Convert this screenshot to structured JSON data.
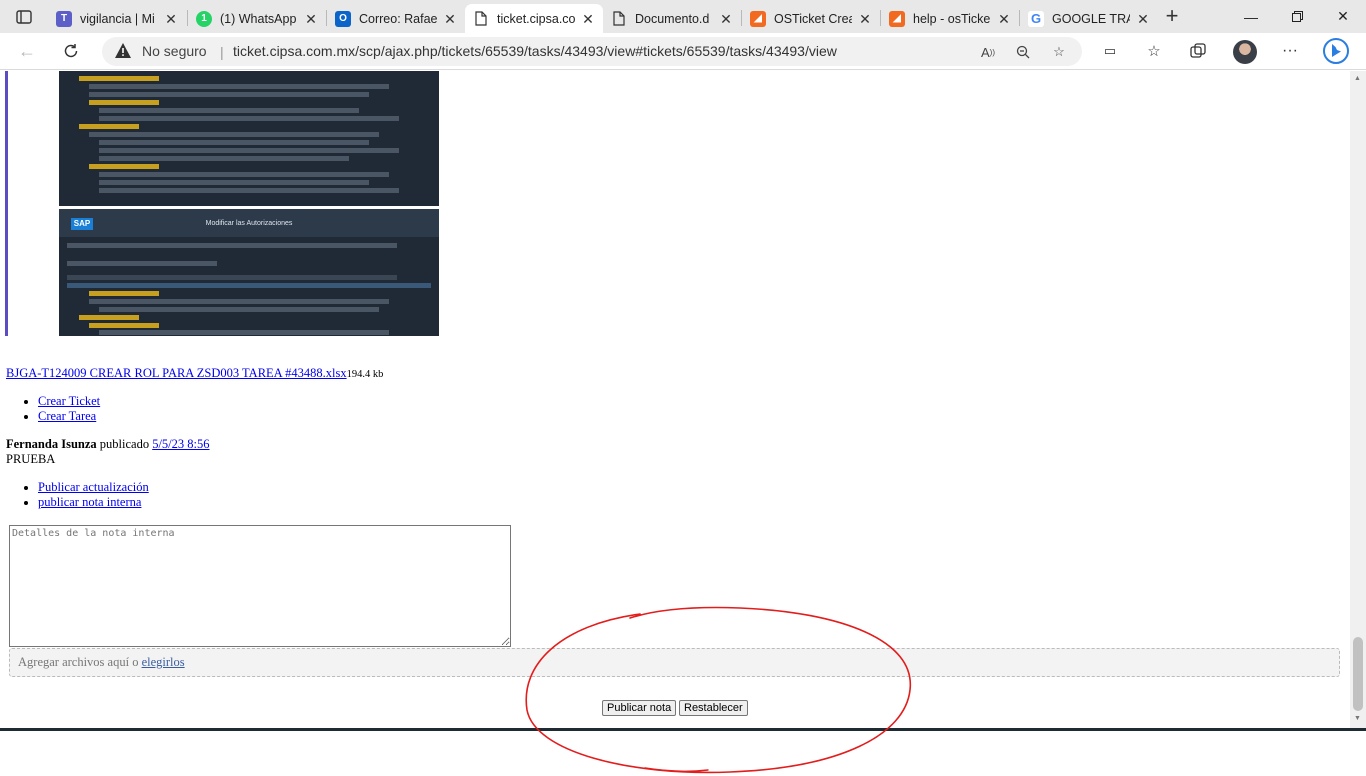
{
  "tabs": [
    {
      "title": "vigilancia | Mi",
      "favicon": "teams-icon",
      "color": "#5b5fc7"
    },
    {
      "title": "(1) WhatsApp",
      "favicon": "whatsapp-icon",
      "color": "#25d366"
    },
    {
      "title": "Correo: Rafael",
      "favicon": "outlook-icon",
      "color": "#0a64c9"
    },
    {
      "title": "ticket.cipsa.co",
      "favicon": "page-icon",
      "color": "#444444",
      "active": true
    },
    {
      "title": "Documento.d",
      "favicon": "page-icon",
      "color": "#444444"
    },
    {
      "title": "OSTicket Crea",
      "favicon": "osticket-icon",
      "color": "#f26a21"
    },
    {
      "title": "help - osTicke",
      "favicon": "osticket-icon",
      "color": "#f26a21"
    },
    {
      "title": "GOOGLE TRAD",
      "favicon": "google-icon",
      "color": "#4285f4"
    }
  ],
  "address": {
    "security_label": "No seguro",
    "url": "ticket.cipsa.com.mx/scp/ajax.php/tickets/65539/tasks/43493/view#tickets/65539/tasks/43493/view"
  },
  "screenshot_title": "Modificar las Autorizaciones",
  "attachment": {
    "name": "BJGA-T124009 CREAR ROL PARA ZSD003 TAREA #43488.xlsx",
    "size": "194.4 kb"
  },
  "actions": {
    "create_ticket": "Crear Ticket",
    "create_task": "Crear Tarea"
  },
  "entry": {
    "author": "Fernanda Isunza",
    "verb": "publicado",
    "date": "5/5/23 8:56",
    "body": "PRUEBA"
  },
  "post_options": {
    "public_update": "Publicar actualización",
    "internal_note": "publicar nota interna"
  },
  "form": {
    "textarea_placeholder": "Detalles de la nota interna",
    "dropzone_text": "Agregar archivos aquí o ",
    "dropzone_link": "elegirlos",
    "submit_label": "Publicar nota",
    "reset_label": "Restablecer"
  },
  "colors": {
    "link": "#0000ee",
    "annotation": "#e31c1c",
    "quote_bar": "#5b4cc4"
  }
}
